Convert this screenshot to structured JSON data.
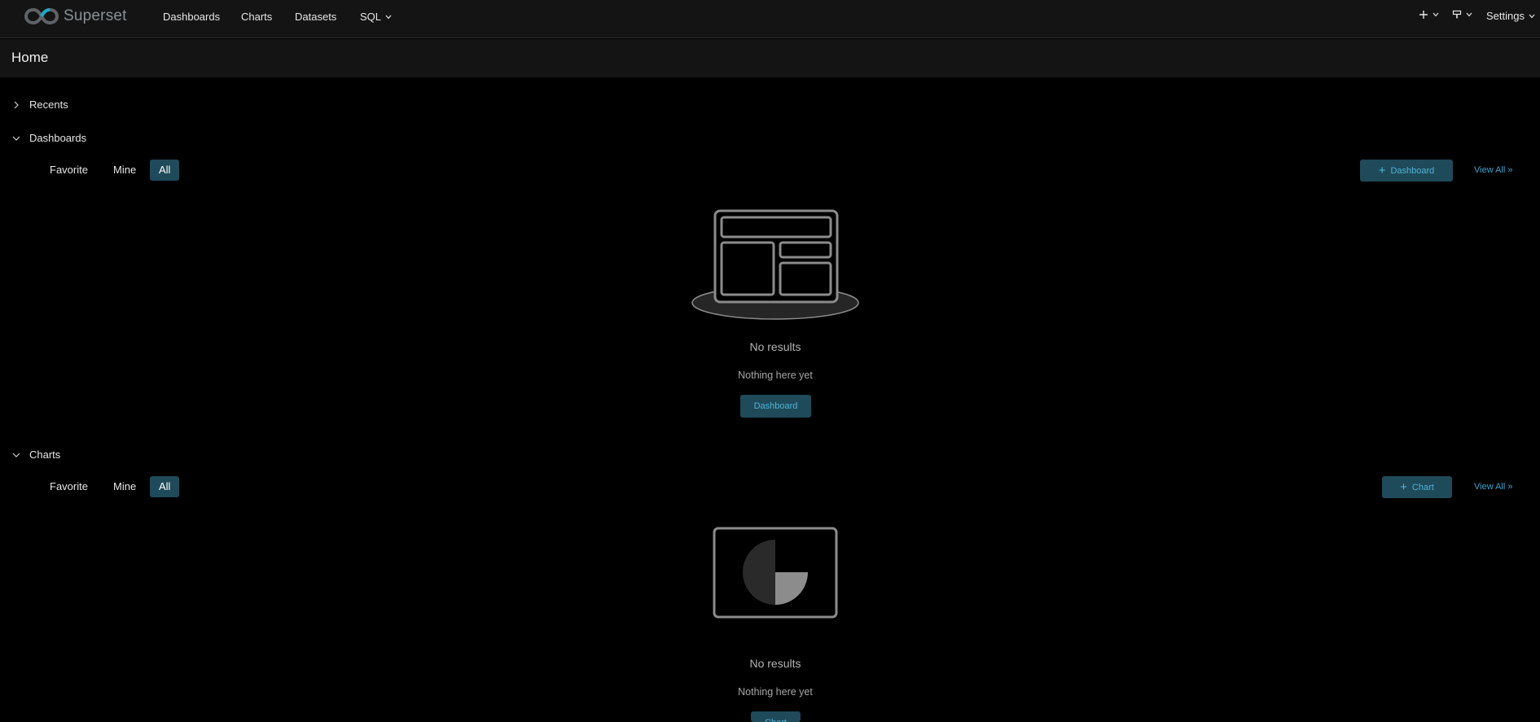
{
  "app": {
    "name": "Superset"
  },
  "nav": {
    "items": [
      {
        "label": "Dashboards"
      },
      {
        "label": "Charts"
      },
      {
        "label": "Datasets"
      },
      {
        "label": "SQL"
      }
    ],
    "settings_label": "Settings"
  },
  "page": {
    "title": "Home"
  },
  "sections": {
    "recents": {
      "label": "Recents"
    },
    "dashboards": {
      "label": "Dashboards",
      "filters": [
        "Favorite",
        "Mine",
        "All"
      ],
      "active_filter": "All",
      "add_button": "Dashboard",
      "view_all": "View All »",
      "empty_title": "No results",
      "empty_description": "Nothing here yet",
      "empty_button": "Dashboard"
    },
    "charts": {
      "label": "Charts",
      "filters": [
        "Favorite",
        "Mine",
        "All"
      ],
      "active_filter": "All",
      "add_button": "Chart",
      "view_all": "View All »",
      "empty_title": "No results",
      "empty_description": "Nothing here yet",
      "empty_button": "Chart"
    }
  },
  "colors": {
    "accent": "#1f4a5a",
    "link": "#3aa5d0",
    "nav_bg": "#141414",
    "background": "#000000"
  },
  "icons": [
    "superset-logo-icon",
    "plus-icon",
    "chevron-down-icon",
    "paint-bucket-icon",
    "chevron-right-icon",
    "dashboard-empty-illustration",
    "chart-empty-illustration"
  ]
}
